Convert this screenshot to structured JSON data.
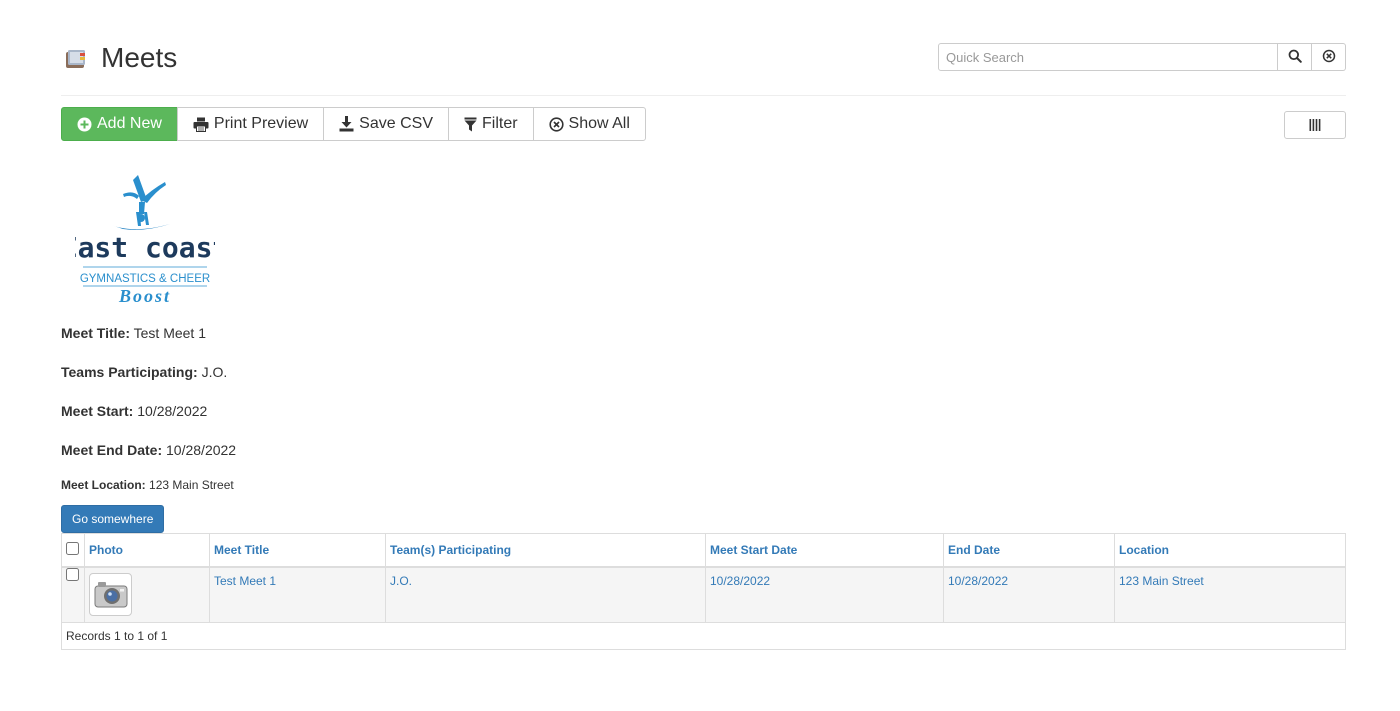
{
  "header": {
    "title": "Meets",
    "search_placeholder": "Quick Search"
  },
  "toolbar": {
    "add_new": "Add New",
    "print_preview": "Print Preview",
    "save_csv": "Save CSV",
    "filter": "Filter",
    "show_all": "Show All"
  },
  "logo": {
    "line1": "East coast",
    "line2": "GYMNASTICS & CHEER",
    "line3": "Boost"
  },
  "details": {
    "meet_title_label": "Meet Title:",
    "meet_title": "Test Meet 1",
    "teams_label": "Teams Participating:",
    "teams": "J.O.",
    "start_label": "Meet Start:",
    "start": "10/28/2022",
    "end_label": "Meet End Date:",
    "end": "10/28/2022",
    "location_label": "Meet Location:",
    "location": "123 Main Street"
  },
  "go_button": "Go somewhere",
  "table": {
    "columns": [
      "Photo",
      "Meet Title",
      "Team(s) Participating",
      "Meet Start Date",
      "End Date",
      "Location"
    ],
    "rows": [
      {
        "title": "Test Meet 1",
        "teams": "J.O.",
        "start": "10/28/2022",
        "end": "10/28/2022",
        "location": "123 Main Street"
      }
    ],
    "footer": "Records 1 to 1 of 1"
  },
  "colors": {
    "primary": "#337ab7",
    "success": "#5cb85c",
    "logo_blue": "#2a8fcd",
    "logo_dark": "#1d3a5c"
  },
  "icons": [
    "book-icon",
    "search-icon",
    "clear-icon",
    "plus-circle-icon",
    "print-icon",
    "download-icon",
    "filter-icon",
    "times-circle-icon",
    "columns-icon",
    "camera-icon"
  ]
}
